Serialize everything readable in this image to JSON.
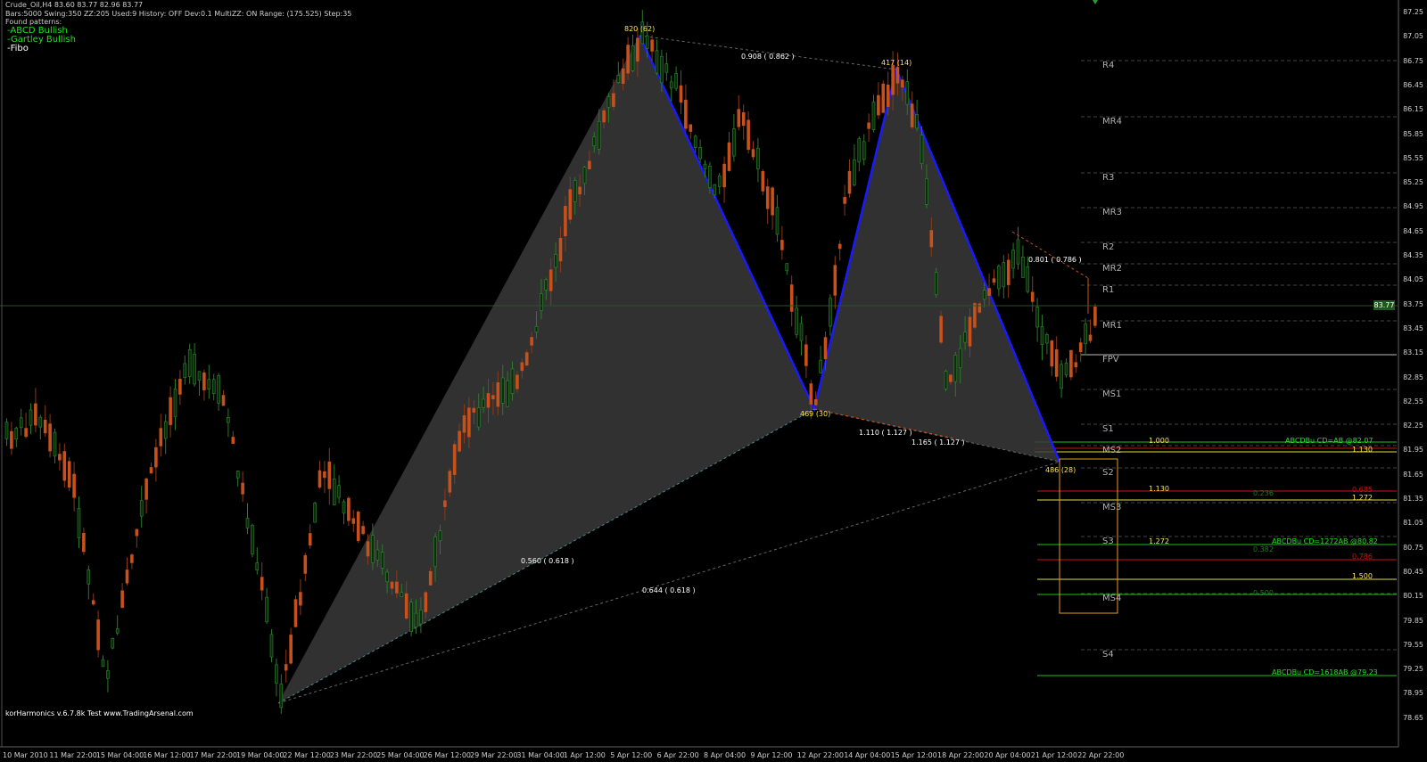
{
  "header": {
    "line1": "Crude_Oil,H4  83.60 83.77 82.96 83.77",
    "line2": "Bars:5000  Swing:350  ZZ:205  Used:9  History: OFF Dev:0.1  MultiZZ: ON  Range: (175.525)  Step:35",
    "found": "Found patterns:",
    "patterns": [
      "-ABCD Bullish",
      "-Gartley Bullish",
      "-Fibo"
    ]
  },
  "colors": {
    "bull": "#2e8b2e",
    "bear": "#c8501a",
    "pattern_line": "#1a1aff",
    "pattern_fill": "#3a3a3a",
    "label_yellow": "#ffe24d",
    "fib_green": "#22c022",
    "fib_red": "#d01010",
    "fib_yellow": "#e0e040",
    "box_orange": "#e0a020"
  },
  "price_axis": [
    "87.25",
    "87.05",
    "86.75",
    "86.45",
    "86.15",
    "85.85",
    "85.55",
    "85.25",
    "84.95",
    "84.65",
    "84.35",
    "84.05",
    "83.75",
    "83.45",
    "83.15",
    "82.85",
    "82.55",
    "82.25",
    "81.95",
    "81.65",
    "81.35",
    "81.05",
    "80.75",
    "80.45",
    "80.15",
    "79.85",
    "79.55",
    "79.25",
    "78.95",
    "78.65"
  ],
  "current_price": "83.77",
  "time_axis": [
    "10 Mar 2010",
    "11 Mar 22:00",
    "15 Mar 04:00",
    "16 Mar 12:00",
    "17 Mar 22:00",
    "19 Mar 04:00",
    "22 Mar 12:00",
    "23 Mar 22:00",
    "25 Mar 04:00",
    "26 Mar 12:00",
    "29 Mar 22:00",
    "31 Mar 04:00",
    "1 Apr 12:00",
    "5 Apr 12:00",
    "6 Apr 22:00",
    "8 Apr 04:00",
    "9 Apr 12:00",
    "12 Apr 22:00",
    "14 Apr 04:00",
    "15 Apr 12:00",
    "18 Apr 22:00",
    "20 Apr 04:00",
    "21 Apr 12:00",
    "22 Apr 22:00"
  ],
  "pivots": [
    "R4",
    "MR4",
    "R3",
    "MR3",
    "R2",
    "MR2",
    "R1",
    "MR1",
    "FPV",
    "MS1",
    "S1",
    "MS2",
    "S2",
    "MS3",
    "S3",
    "MS4",
    "S4"
  ],
  "points": {
    "X": "820 (62)",
    "A": "417 (14)",
    "B": "469 (30)",
    "C": "486 (28)"
  },
  "ratios": {
    "xa": "0.908 ( 0.862 )",
    "cd": "0.801 ( 0.786 )",
    "bc1": "1.110 ( 1.127 )",
    "bc2": "1.165 ( 1.127 )",
    "ab": "0.560 ( 0.618 )",
    "xb": "0.644 ( 0.618 )"
  },
  "fib_labels": {
    "a1000": "1.000",
    "abcd1": "ABCDBu CD=AB  @82.07",
    "r1130": "1.130",
    "b1130": "1.130",
    "g0236": "0.236",
    "r0685": "0.685",
    "y1272a": "1.272",
    "b1272": "1.272",
    "abcd2": "ABCDBu CD=1272AB  @80.82",
    "g0382": "0.382",
    "r0786": "0.786",
    "y1500": "1.500",
    "g0500": "0.500",
    "abcd3": "ABCDBu CD=1618AB  @79.23"
  },
  "footer": "korHarmonics v.6.7.8k Test www.TradingArsenal.com"
}
